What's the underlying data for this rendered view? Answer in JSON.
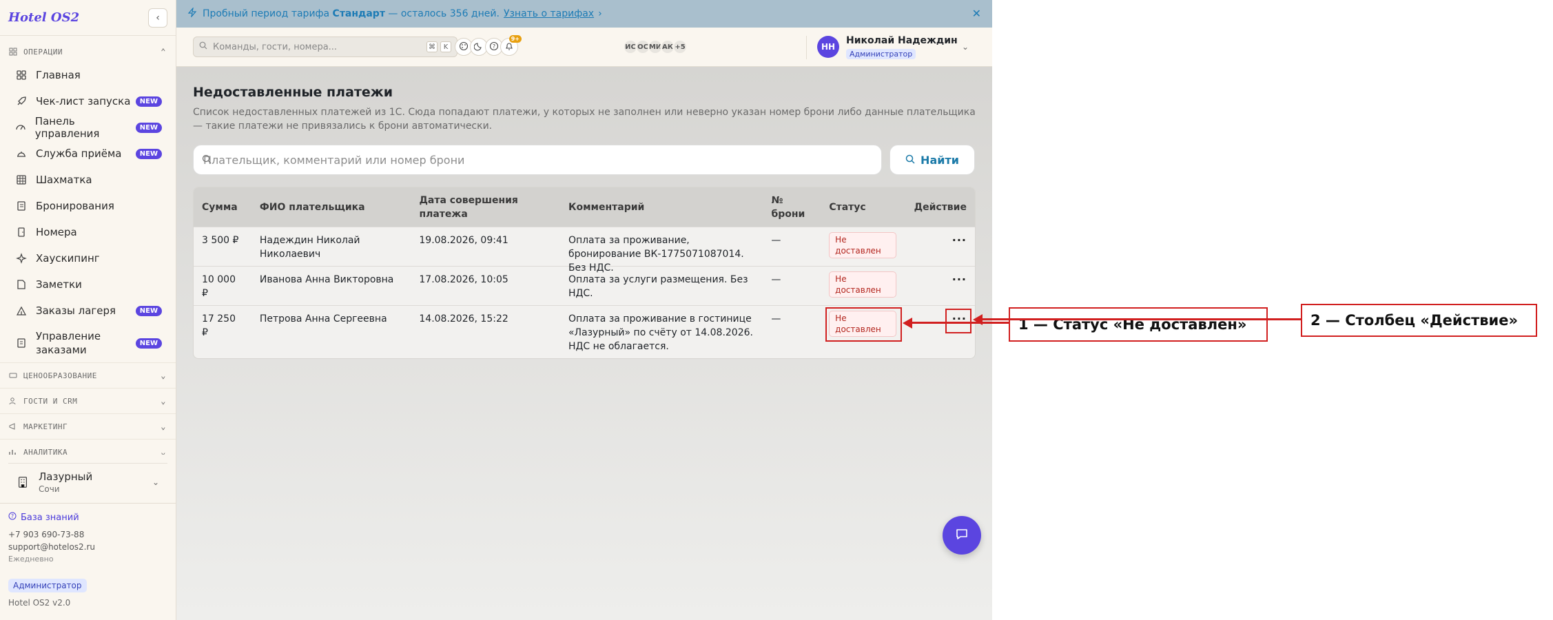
{
  "app": {
    "logo": "Hotel OS2"
  },
  "banner": {
    "text_before": "Пробный период тарифа ",
    "plan": "Стандарт",
    "text_after": " — осталось 356 дней.",
    "link": "Узнать о тарифах",
    "link_arrow": "›",
    "close": "✕"
  },
  "header": {
    "search_placeholder": "Команды, гости, номера...",
    "kbd": [
      "⌘",
      "K"
    ],
    "avatars": [
      "ИС",
      "ОС",
      "МИ",
      "АК",
      "+5"
    ],
    "notif_count": "9+",
    "user": {
      "initials": "НН",
      "name": "Николай Надеждин",
      "role": "Администратор"
    }
  },
  "sidebar": {
    "sections": {
      "operations": "ОПЕРАЦИИ",
      "pricing": "ЦЕНООБРАЗОВАНИЕ",
      "guests": "ГОСТИ И CRM",
      "marketing": "МАРКЕТИНГ",
      "analytics": "АНАЛИТИКА"
    },
    "items": [
      {
        "label": "Главная",
        "icon": "grid-icon",
        "new": false
      },
      {
        "label": "Чек-лист запуска",
        "icon": "rocket-icon",
        "new": true
      },
      {
        "label": "Панель управления",
        "icon": "gauge-icon",
        "new": true
      },
      {
        "label": "Служба приёма",
        "icon": "bell-desk-icon",
        "new": true
      },
      {
        "label": "Шахматка",
        "icon": "table-grid-icon",
        "new": false
      },
      {
        "label": "Бронирования",
        "icon": "notebook-icon",
        "new": false
      },
      {
        "label": "Номера",
        "icon": "door-icon",
        "new": false
      },
      {
        "label": "Хаускипинг",
        "icon": "sparkle-icon",
        "new": false
      },
      {
        "label": "Заметки",
        "icon": "note-icon",
        "new": false
      },
      {
        "label": "Заказы лагеря",
        "icon": "tent-icon",
        "new": true
      },
      {
        "label": "Управление заказами",
        "icon": "receipt-icon",
        "new": true
      }
    ],
    "new_badge": "NEW",
    "hotel": {
      "name": "Лазурный",
      "city": "Сочи"
    },
    "footer": {
      "kb": "База знаний",
      "phone": "+7 903 690-73-88",
      "email": "support@hotelos2.ru",
      "schedule": "Ежедневно",
      "role": "Администратор",
      "version": "Hotel OS2 v2.0"
    }
  },
  "main": {
    "title": "Недоставленные платежи",
    "description": "Список недоставленных платежей из 1С. Сюда попадают платежи, у которых не заполнен или неверно указан номер брони либо данные плательщика — такие платежи не привязались к брони автоматически.",
    "search_placeholder": "Плательщик, комментарий или номер брони",
    "find_label": "Найти",
    "columns": [
      "Сумма",
      "ФИО плательщика",
      "Дата совершения платежа",
      "Комментарий",
      "№ брони",
      "Статус",
      "Действие"
    ],
    "rows": [
      {
        "amount": "3 500 ₽",
        "payer": "Надеждин Николай Николаевич",
        "date": "19.08.2026, 09:41",
        "comment": "Оплата за проживание, бронирование ВК-1775071087014. Без НДС.",
        "booking": "—",
        "status": "Не доставлен",
        "action": "···"
      },
      {
        "amount": "10 000 ₽",
        "payer": "Иванова Анна Викторовна",
        "date": "17.08.2026, 10:05",
        "comment": "Оплата за услуги размещения. Без НДС.",
        "booking": "—",
        "status": "Не доставлен",
        "action": "···"
      },
      {
        "amount": "17 250 ₽",
        "payer": "Петрова Анна Сергеевна",
        "date": "14.08.2026, 15:22",
        "comment": "Оплата за проживание в гостинице «Лазурный» по счёту от 14.08.2026. НДС не облагается.",
        "booking": "—",
        "status": "Не доставлен",
        "action": "···"
      }
    ]
  },
  "annotations": {
    "label1": "1 — Статус «Не доставлен»",
    "label2": "2 — Столбец «Действие»"
  },
  "colors": {
    "accent": "#5b45e0",
    "annotation": "#d11f1f",
    "banner": "#a9bfcd",
    "status_text": "#b3261e"
  }
}
